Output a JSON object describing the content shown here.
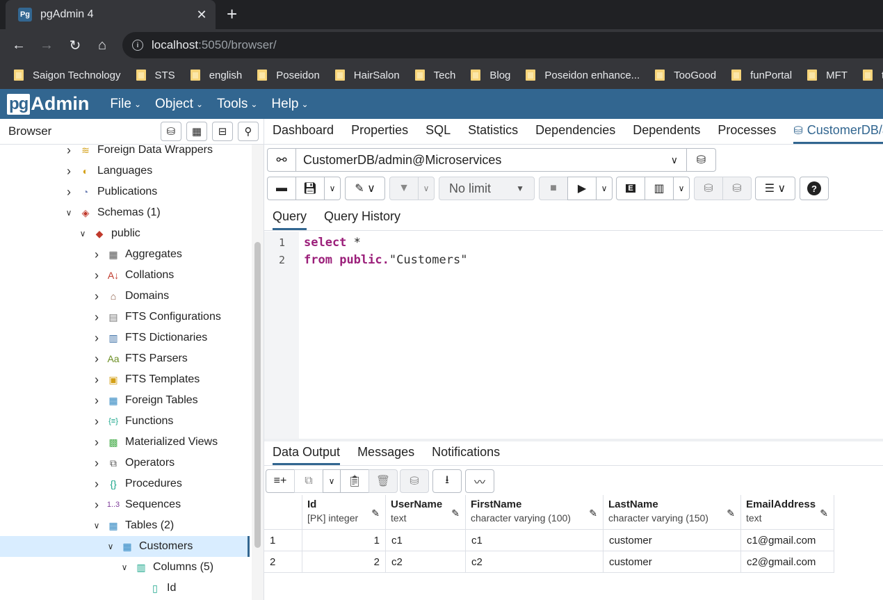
{
  "browser": {
    "tab_title": "pgAdmin 4",
    "favicon_text": "Pg",
    "url_host": "localhost",
    "url_path": ":5050/browser/",
    "bookmarks": [
      "Saigon Technology",
      "STS",
      "english",
      "Poseidon",
      "HairSalon",
      "Tech",
      "Blog",
      "Poseidon enhance...",
      "TooGood",
      "funPortal",
      "MFT",
      "t"
    ]
  },
  "app": {
    "logo_pg": "pg",
    "logo_admin": "Admin",
    "menu": [
      "File",
      "Object",
      "Tools",
      "Help"
    ]
  },
  "left_panel": {
    "title": "Browser",
    "tree": [
      {
        "label": "Foreign Data Wrappers",
        "toggle": "›",
        "icon": "foreign-data-wrapper-icon",
        "glyph": "≋",
        "color": "#d4a017"
      },
      {
        "label": "Languages",
        "toggle": "›",
        "icon": "language-icon",
        "glyph": "◐",
        "color": "#d4a017"
      },
      {
        "label": "Publications",
        "toggle": "›",
        "icon": "publication-icon",
        "glyph": "◔",
        "color": "#6a7db3"
      },
      {
        "label": "Schemas (1)",
        "toggle": "⌄",
        "icon": "schemas-icon",
        "glyph": "◈",
        "color": "#c0392b"
      },
      {
        "label": "public",
        "toggle": "⌄",
        "icon": "schema-icon",
        "glyph": "◆",
        "color": "#c0392b"
      },
      {
        "label": "Aggregates",
        "toggle": "›",
        "icon": "aggregate-icon",
        "glyph": "▦",
        "color": "#555"
      },
      {
        "label": "Collations",
        "toggle": "›",
        "icon": "collation-icon",
        "glyph": "A↓",
        "color": "#c0392b"
      },
      {
        "label": "Domains",
        "toggle": "›",
        "icon": "domain-icon",
        "glyph": "⌂",
        "color": "#8a5a44"
      },
      {
        "label": "FTS Configurations",
        "toggle": "›",
        "icon": "fts-configuration-icon",
        "glyph": "▤",
        "color": "#777"
      },
      {
        "label": "FTS Dictionaries",
        "toggle": "›",
        "icon": "fts-dictionary-icon",
        "glyph": "▥",
        "color": "#3a6ea5"
      },
      {
        "label": "FTS Parsers",
        "toggle": "›",
        "icon": "fts-parser-icon",
        "glyph": "Aa",
        "color": "#6b8e23"
      },
      {
        "label": "FTS Templates",
        "toggle": "›",
        "icon": "fts-template-icon",
        "glyph": "▣",
        "color": "#d4a017"
      },
      {
        "label": "Foreign Tables",
        "toggle": "›",
        "icon": "foreign-table-icon",
        "glyph": "▦",
        "color": "#2e86c1"
      },
      {
        "label": "Functions",
        "toggle": "›",
        "icon": "function-icon",
        "glyph": "{≡}",
        "color": "#17a589"
      },
      {
        "label": "Materialized Views",
        "toggle": "›",
        "icon": "materialized-view-icon",
        "glyph": "▩",
        "color": "#4caf50"
      },
      {
        "label": "Operators",
        "toggle": "›",
        "icon": "operator-icon",
        "glyph": "⧉",
        "color": "#555"
      },
      {
        "label": "Procedures",
        "toggle": "›",
        "icon": "procedure-icon",
        "glyph": "{}",
        "color": "#17a589"
      },
      {
        "label": "Sequences",
        "toggle": "›",
        "icon": "sequence-icon",
        "glyph": "1..3",
        "color": "#7d3c98"
      },
      {
        "label": "Tables (2)",
        "toggle": "⌄",
        "icon": "tables-icon",
        "glyph": "▦",
        "color": "#2e86c1"
      },
      {
        "label": "Customers",
        "toggle": "⌄",
        "icon": "table-icon",
        "glyph": "▦",
        "color": "#2e86c1"
      },
      {
        "label": "Columns (5)",
        "toggle": "⌄",
        "icon": "columns-icon",
        "glyph": "▥",
        "color": "#17a589"
      },
      {
        "label": "Id",
        "toggle": "",
        "icon": "column-icon",
        "glyph": "▯",
        "color": "#17a589"
      }
    ]
  },
  "right_tabs": [
    "Dashboard",
    "Properties",
    "SQL",
    "Statistics",
    "Dependencies",
    "Dependents",
    "Processes"
  ],
  "active_tab": "CustomerDB/admin@Microservices",
  "connection": "CustomerDB/admin@Microservices",
  "limit_label": "No limit",
  "query_tabs": [
    "Query",
    "Query History"
  ],
  "code_lines": [
    {
      "num": "1",
      "kw": "select",
      "rest": " *"
    },
    {
      "num": "2",
      "kw": "from",
      "rest": " ",
      "schema": "public.",
      "ident": "\"Customers\""
    }
  ],
  "output_tabs": [
    "Data Output",
    "Messages",
    "Notifications"
  ],
  "grid": {
    "columns": [
      {
        "name": "Id",
        "type": "[PK] integer"
      },
      {
        "name": "UserName",
        "type": "text"
      },
      {
        "name": "FirstName",
        "type": "character varying (100)"
      },
      {
        "name": "LastName",
        "type": "character varying (150)"
      },
      {
        "name": "EmailAddress",
        "type": "text"
      }
    ],
    "rows": [
      {
        "n": "1",
        "cells": [
          "1",
          "c1",
          "c1",
          "customer",
          "c1@gmail.com"
        ]
      },
      {
        "n": "2",
        "cells": [
          "2",
          "c2",
          "c2",
          "customer",
          "c2@gmail.com"
        ]
      }
    ]
  }
}
